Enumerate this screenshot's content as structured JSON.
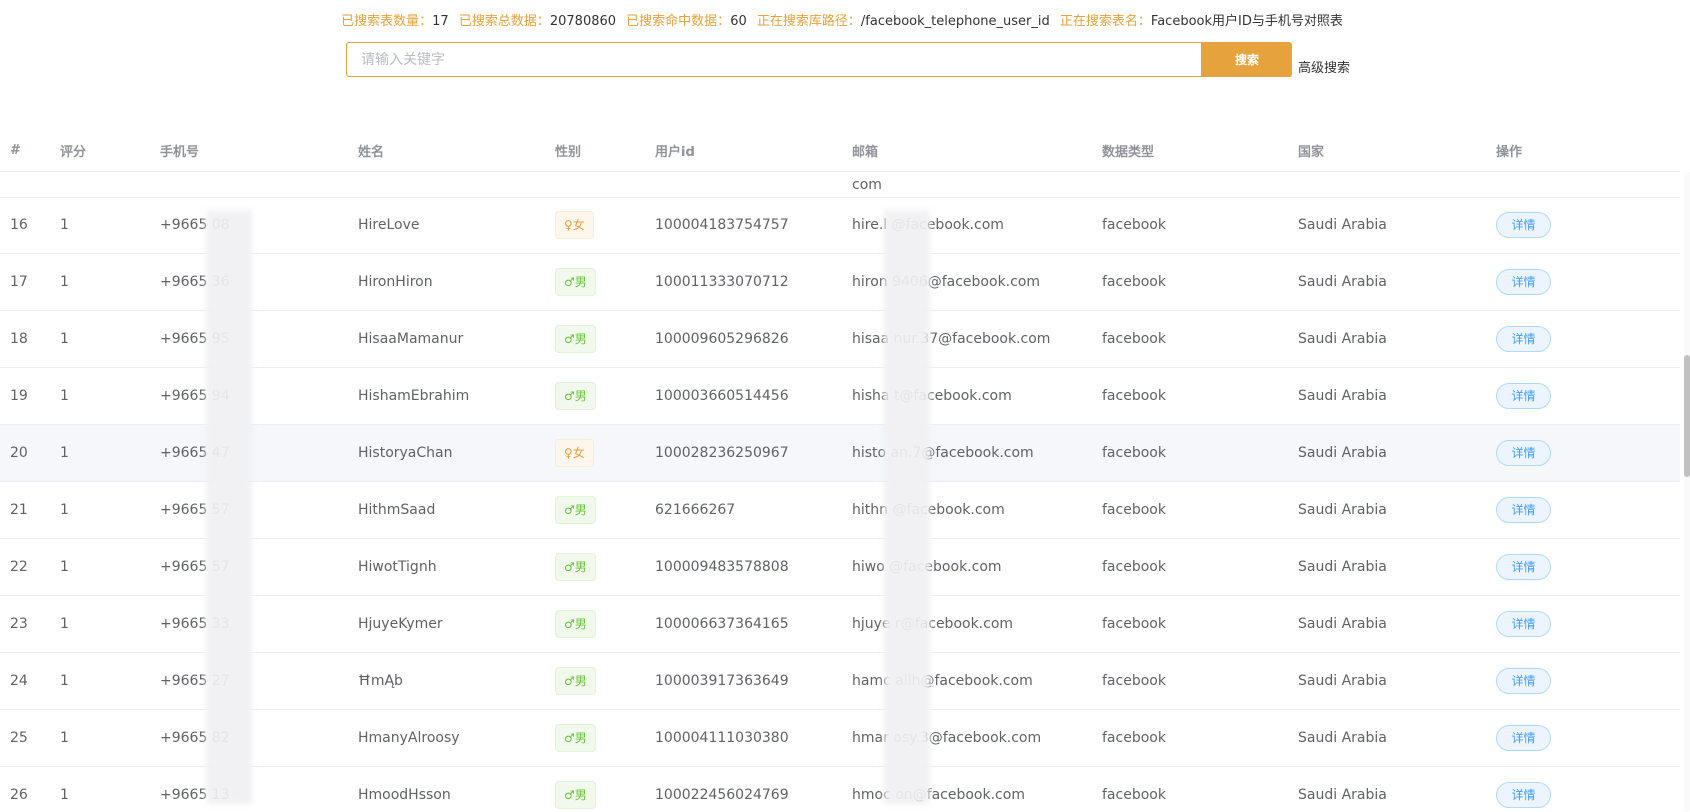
{
  "status": {
    "tables_label": "已搜索表数量：",
    "tables_value": "17",
    "total_label": "已搜索总数据：",
    "total_value": "20780860",
    "hits_label": "已搜索命中数据：",
    "hits_value": "60",
    "path_label": "正在搜索库路径：",
    "path_value": "/facebook_telephone_user_id",
    "table_label": "正在搜索表名：",
    "table_value": "Facebook用户ID与手机号对照表"
  },
  "search": {
    "placeholder": "请输入关键字",
    "button": "搜索",
    "advanced": "高级搜索"
  },
  "columns": [
    "#",
    "评分",
    "手机号",
    "姓名",
    "性别",
    "用户id",
    "邮箱",
    "数据类型",
    "国家",
    "操作"
  ],
  "partial_row": {
    "email": "com"
  },
  "rows": [
    {
      "no": "16",
      "score": "1",
      "phone": "+9665    08",
      "name": "HireLove",
      "gender": "♀女",
      "gtype": "female",
      "uid": "100004183754757",
      "email": "hire.l      @facebook.com",
      "dtype": "facebook",
      "country": "Saudi Arabia",
      "action": "详情"
    },
    {
      "no": "17",
      "score": "1",
      "phone": "+9665    36",
      "name": "HironHiron",
      "gender": "♂男",
      "gtype": "male",
      "uid": "100011333070712",
      "email": "hiron      9406@facebook.com",
      "dtype": "facebook",
      "country": "Saudi Arabia",
      "action": "详情"
    },
    {
      "no": "18",
      "score": "1",
      "phone": "+9665    95",
      "name": "HisaaMamanur",
      "gender": "♂男",
      "gtype": "male",
      "uid": "100009605296826",
      "email": "hisaa      nur.37@facebook.com",
      "dtype": "facebook",
      "country": "Saudi Arabia",
      "action": "详情"
    },
    {
      "no": "19",
      "score": "1",
      "phone": "+9665    94",
      "name": "HishamEbrahim",
      "gender": "♂男",
      "gtype": "male",
      "uid": "100003660514456",
      "email": "hisha      t@facebook.com",
      "dtype": "facebook",
      "country": "Saudi Arabia",
      "action": "详情"
    },
    {
      "no": "20",
      "score": "1",
      "phone": "+9665    47",
      "name": "HistoryaChan",
      "gender": "♀女",
      "gtype": "female",
      "uid": "100028236250967",
      "email": "histo      an.7@facebook.com",
      "dtype": "facebook",
      "country": "Saudi Arabia",
      "action": "详情"
    },
    {
      "no": "21",
      "score": "1",
      "phone": "+9665    57",
      "name": "HithmSaad",
      "gender": "♂男",
      "gtype": "male",
      "uid": "621666267",
      "email": "hithn      @facebook.com",
      "dtype": "facebook",
      "country": "Saudi Arabia",
      "action": "详情"
    },
    {
      "no": "22",
      "score": "1",
      "phone": "+9665    57",
      "name": "HiwotTignh",
      "gender": "♂男",
      "gtype": "male",
      "uid": "100009483578808",
      "email": "hiwo      @facebook.com",
      "dtype": "facebook",
      "country": "Saudi Arabia",
      "action": "详情"
    },
    {
      "no": "23",
      "score": "1",
      "phone": "+9665    33",
      "name": "HjuyeKymer",
      "gender": "♂男",
      "gtype": "male",
      "uid": "100006637364165",
      "email": "hjuye      r@facebook.com",
      "dtype": "facebook",
      "country": "Saudi Arabia",
      "action": "详情"
    },
    {
      "no": "24",
      "score": "1",
      "phone": "+9665    27",
      "name": "ĦmĄb",
      "gender": "♂男",
      "gtype": "male",
      "uid": "100003917363649",
      "email": "hamc      allh@facebook.com",
      "dtype": "facebook",
      "country": "Saudi Arabia",
      "action": "详情"
    },
    {
      "no": "25",
      "score": "1",
      "phone": "+9665    82",
      "name": "HmanyAlroosy",
      "gender": "♂男",
      "gtype": "male",
      "uid": "100004111030380",
      "email": "hmar      osy.3@facebook.com",
      "dtype": "facebook",
      "country": "Saudi Arabia",
      "action": "详情"
    },
    {
      "no": "26",
      "score": "1",
      "phone": "+9665    13",
      "name": "HmoodHsson",
      "gender": "♂男",
      "gtype": "male",
      "uid": "100022456024769",
      "email": "hmoc      on@facebook.com",
      "dtype": "facebook",
      "country": "Saudi Arabia",
      "action": "详情"
    }
  ]
}
